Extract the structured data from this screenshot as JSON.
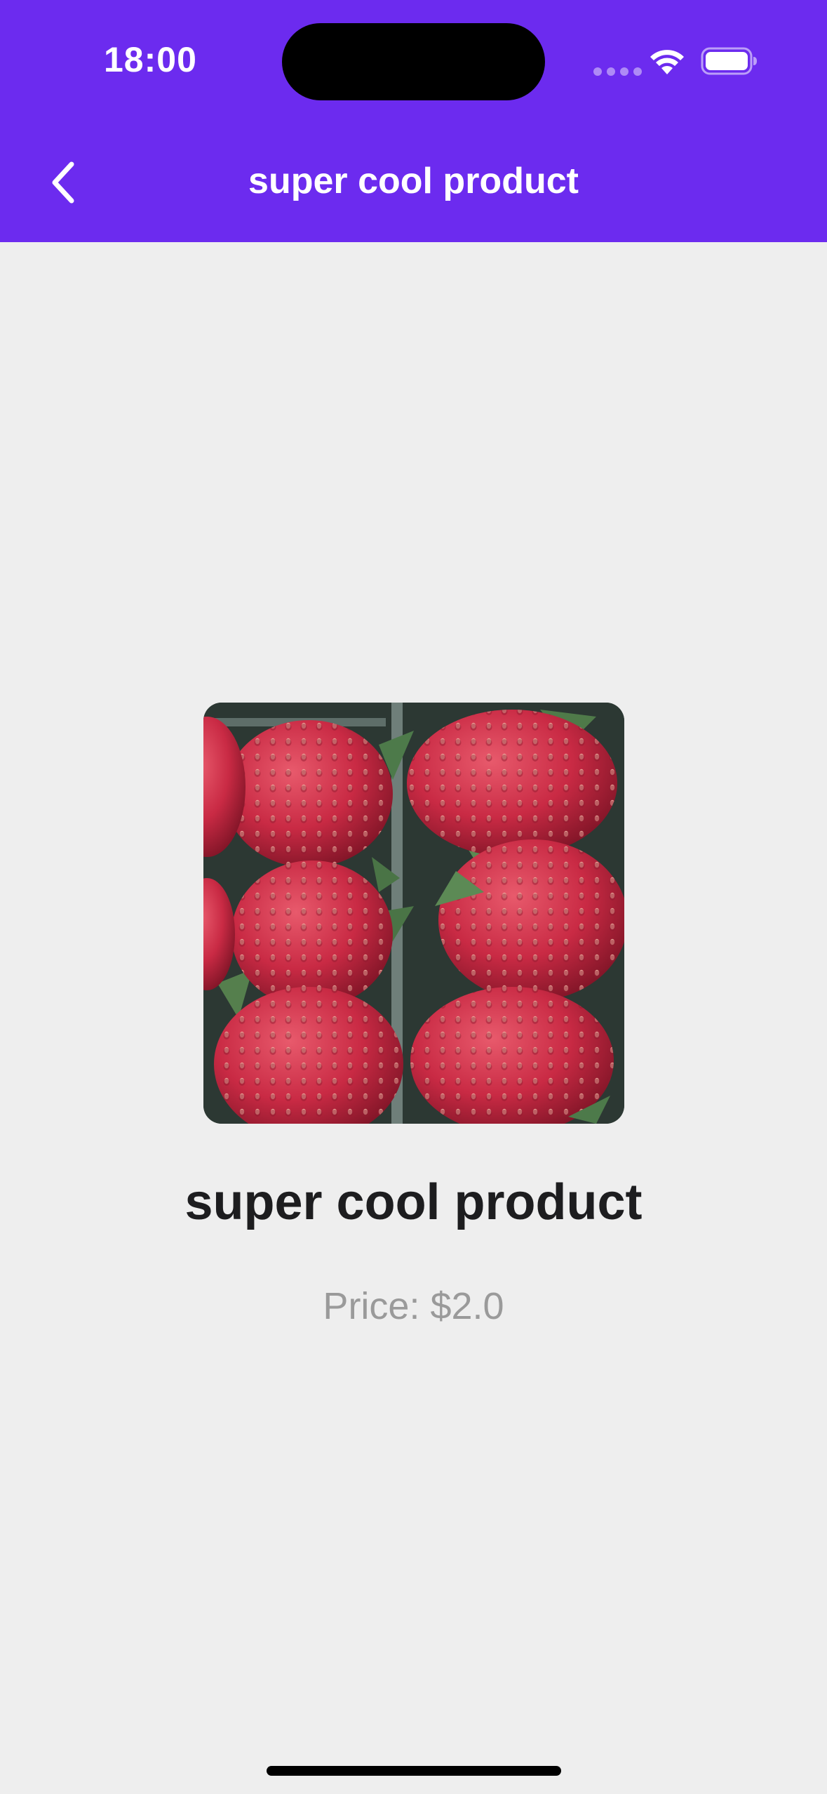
{
  "status_bar": {
    "time": "18:00"
  },
  "app_bar": {
    "title": "super cool product",
    "back_icon": "chevron-left-icon",
    "background_color": "#6c2bef"
  },
  "product": {
    "image": "strawberries-photo",
    "name": "super cool product",
    "price_text": "Price: $2.0"
  },
  "colors": {
    "accent": "#6c2bef",
    "background": "#eeeeee",
    "title_text": "#1d1d1f",
    "price_text": "#9a9a9a"
  }
}
